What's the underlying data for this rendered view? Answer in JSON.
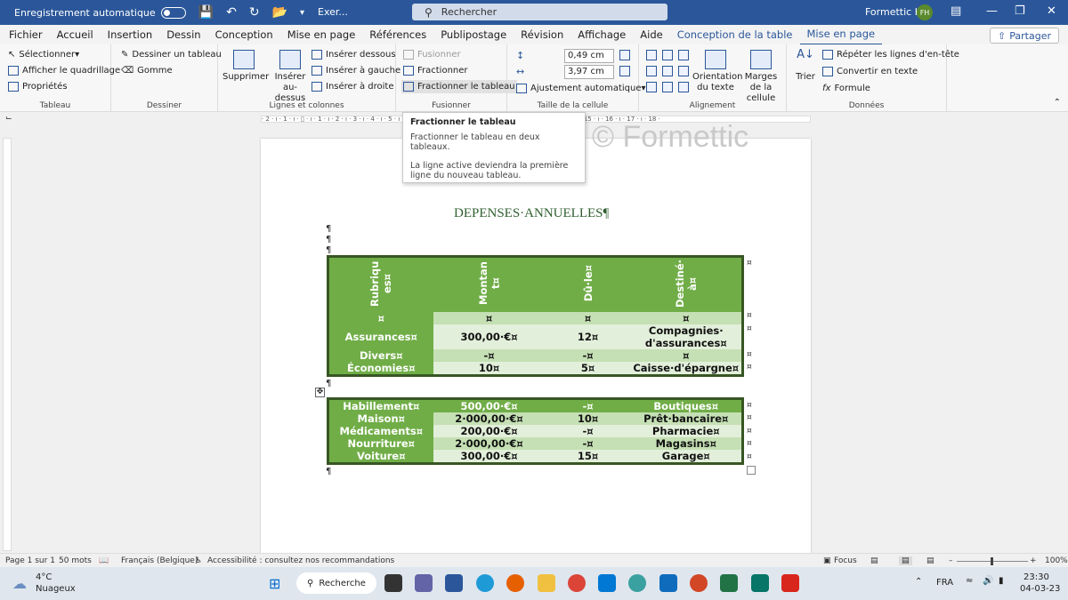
{
  "titlebar": {
    "autosave_label": "Enregistrement automatique",
    "doc_name": "Exer...",
    "search_placeholder": "Rechercher",
    "user_name": "Formettic H",
    "user_initials": "FH"
  },
  "ribbon_tabs": [
    "Fichier",
    "Accueil",
    "Insertion",
    "Dessin",
    "Conception",
    "Mise en page",
    "Références",
    "Publipostage",
    "Révision",
    "Affichage",
    "Aide",
    "Conception de la table",
    "Mise en page"
  ],
  "share_label": "Partager",
  "ribbon": {
    "tableau": {
      "label": "Tableau",
      "select": "Sélectionner",
      "gridlines": "Afficher le quadrillage",
      "properties": "Propriétés"
    },
    "dessiner": {
      "label": "Dessiner",
      "draw_table": "Dessiner un tableau",
      "eraser": "Gomme"
    },
    "lignes": {
      "label": "Lignes et colonnes",
      "delete": "Supprimer",
      "insert_above": "Insérer au-dessus",
      "insert_below": "Insérer dessous",
      "insert_left": "Insérer à gauche",
      "insert_right": "Insérer à droite"
    },
    "fusionner": {
      "label": "Fusionner",
      "merge": "Fusionner",
      "split_cells": "Fractionner",
      "split_table": "Fractionner le tableau"
    },
    "taille": {
      "label": "Taille de la cellule",
      "height": "0,49 cm",
      "width": "3,97 cm",
      "autofit": "Ajustement automatique"
    },
    "alignement": {
      "label": "Alignement",
      "orientation": "Orientation du texte",
      "margins": "Marges de la cellule"
    },
    "donnees": {
      "label": "Données",
      "sort": "Trier",
      "repeat_header": "Répéter les lignes d'en-tête",
      "convert": "Convertir en texte",
      "formula": "Formule"
    }
  },
  "tooltip": {
    "title": "Fractionner le tableau",
    "desc1": "Fractionner le tableau en deux tableaux.",
    "desc2": "La ligne active deviendra la première ligne du nouveau tableau."
  },
  "watermark": "© Formettic",
  "document": {
    "title": "DEPENSES·ANNUELLES¶",
    "pilcrow": "¶",
    "table1": {
      "headers": [
        "Rubriqu es¤",
        "Montan t¤",
        "Dû·le¤",
        "Destiné· à¤"
      ],
      "rows": [
        [
          "¤",
          "¤",
          "¤",
          "¤"
        ],
        [
          "Assurances¤",
          "300,00·€¤",
          "12¤",
          "Compagnies· d'assurances¤"
        ],
        [
          "Divers¤",
          "-¤",
          "-¤",
          "¤"
        ],
        [
          "Économies¤",
          "10¤",
          "5¤",
          "Caisse·d'épargne¤"
        ]
      ]
    },
    "table2": {
      "rows": [
        [
          "Habillement¤",
          "500,00·€¤",
          "-¤",
          "Boutiques¤"
        ],
        [
          "Maison¤",
          "2·000,00·€¤",
          "10¤",
          "Prêt·bancaire¤"
        ],
        [
          "Médicaments¤",
          "200,00·€¤",
          "-¤",
          "Pharmacie¤"
        ],
        [
          "Nourriture¤",
          "2·000,00·€¤",
          "-¤",
          "Magasins¤"
        ],
        [
          "Voiture¤",
          "300,00·€¤",
          "15¤",
          "Garage¤"
        ]
      ]
    },
    "cell_mark": "¤"
  },
  "statusbar": {
    "page": "Page 1 sur 1",
    "words": "50 mots",
    "language": "Français (Belgique)",
    "accessibility": "Accessibilité : consultez nos recommandations",
    "focus": "Focus",
    "zoom": "100%"
  },
  "taskbar": {
    "temp": "4°C",
    "weather": "Nuageux",
    "search": "Recherche",
    "lang": "FRA",
    "time": "23:30",
    "date": "04-03-23"
  },
  "colors": {
    "word_blue": "#2b579a",
    "table_dark": "#70ad47",
    "table_mid": "#c5e0b4",
    "table_light": "#e2efda",
    "border": "#375623"
  }
}
